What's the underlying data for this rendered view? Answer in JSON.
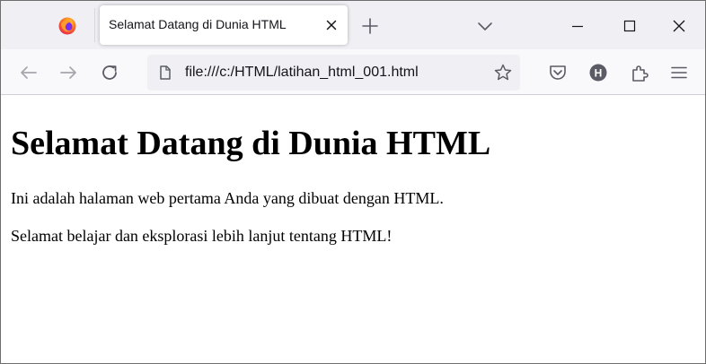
{
  "tab": {
    "title": "Selamat Datang di Dunia HTML"
  },
  "urlbar": {
    "url": "file:///c:/HTML/latihan_html_001.html"
  },
  "toolbar": {
    "account_initial": "H"
  },
  "page": {
    "heading": "Selamat Datang di Dunia HTML",
    "paragraphs": [
      "Ini adalah halaman web pertama Anda yang dibuat dengan HTML.",
      "Selamat belajar dan eksplorasi lebih lanjut tentang HTML!"
    ]
  },
  "icons": {
    "app": "firefox-icon",
    "tab_close": "close-icon",
    "new_tab": "plus-icon",
    "tab_list": "chevron-down-icon",
    "minimize": "minimize-icon",
    "maximize": "maximize-icon",
    "window_close": "close-icon",
    "back": "back-arrow-icon",
    "forward": "forward-arrow-icon",
    "reload": "reload-icon",
    "page": "page-icon",
    "bookmark": "star-icon",
    "pocket": "pocket-icon",
    "account": "account-icon",
    "extensions": "extensions-icon",
    "menu": "hamburger-menu-icon"
  },
  "colors": {
    "tabstrip_bg": "#f0f0f4",
    "navbar_bg": "#f9f9fb",
    "urlbar_bg": "#f0f0f4",
    "icon_color": "#5b5b66",
    "disabled_icon": "#a6a6ad"
  }
}
